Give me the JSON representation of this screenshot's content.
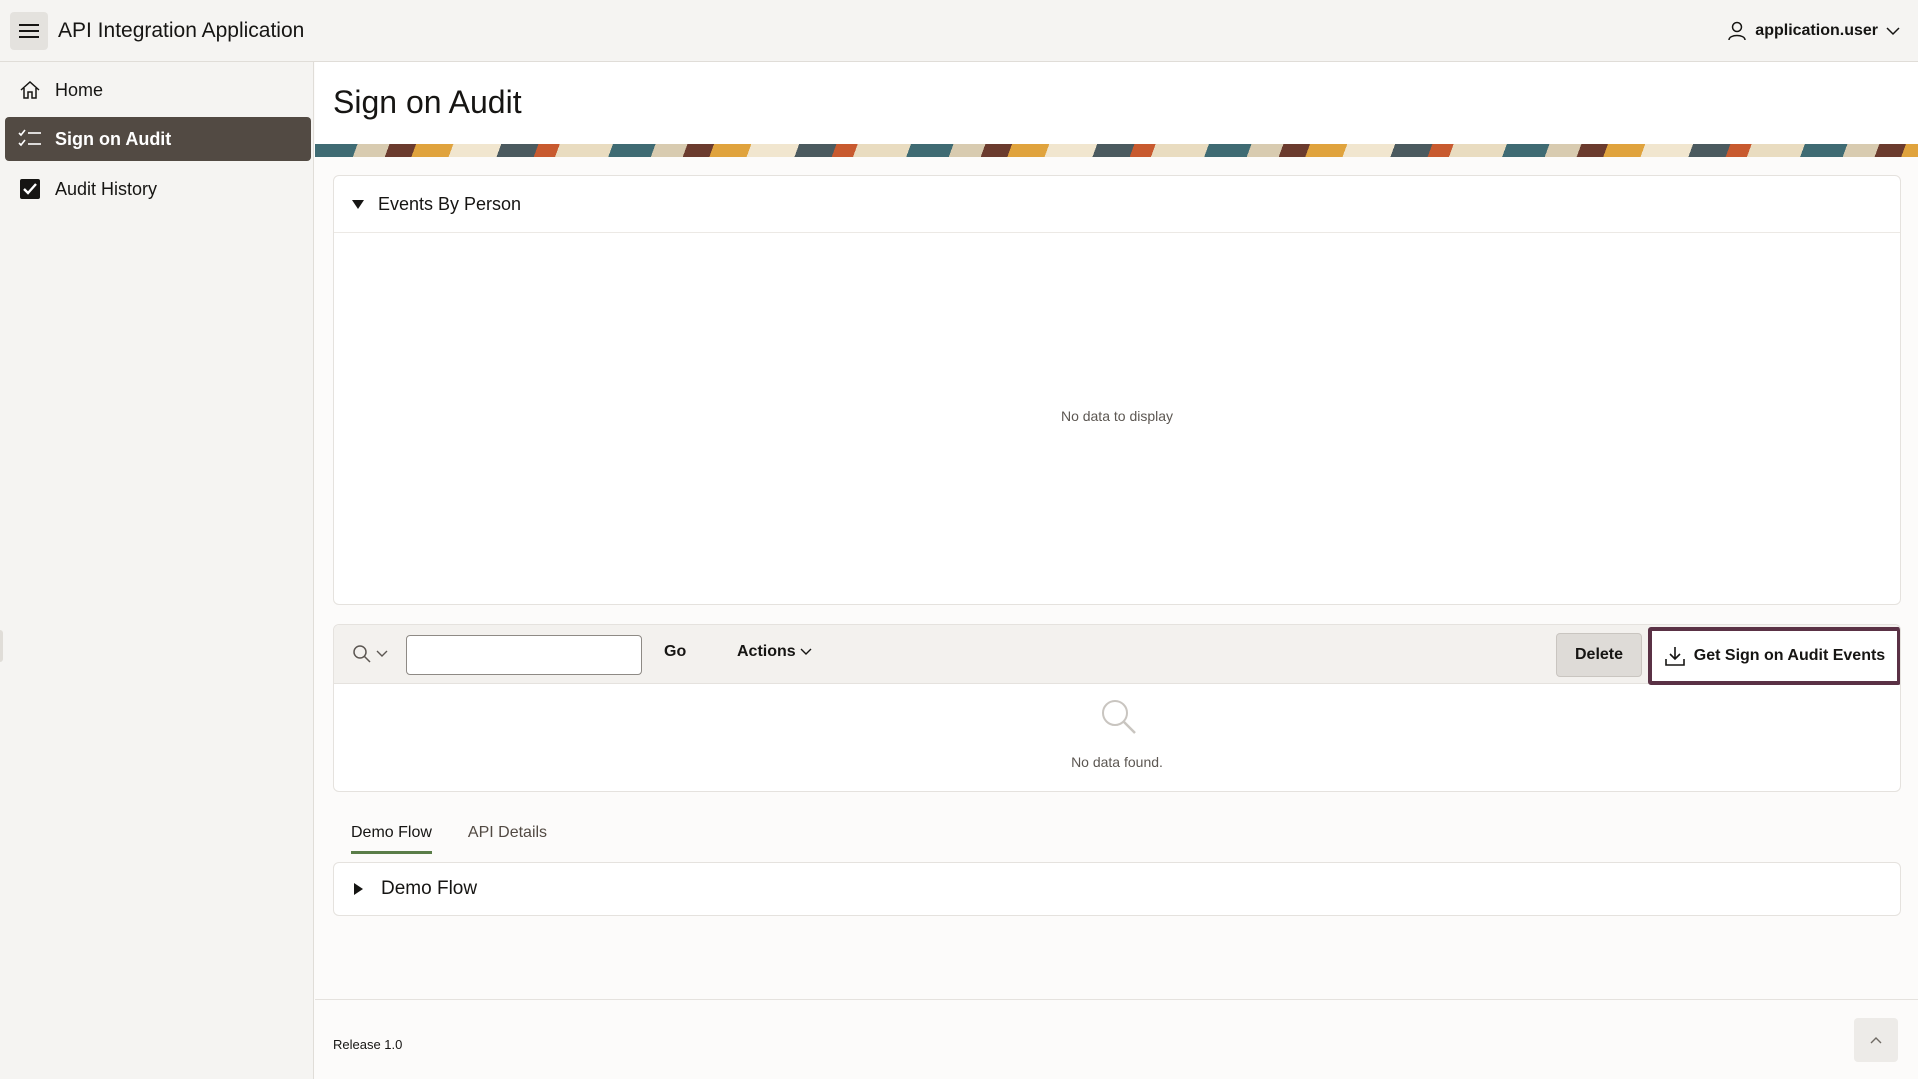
{
  "header": {
    "app_title": "API Integration Application",
    "user": "application.user"
  },
  "sidebar": {
    "items": [
      {
        "label": "Home",
        "icon": "home-icon"
      },
      {
        "label": "Sign on Audit",
        "icon": "checklist-icon",
        "active": true
      },
      {
        "label": "Audit History",
        "icon": "checkbox-icon"
      }
    ]
  },
  "main": {
    "page_title": "Sign on Audit",
    "chart_region": {
      "title": "Events By Person",
      "empty_message": "No data to display"
    },
    "report": {
      "search_placeholder": "",
      "go_label": "Go",
      "actions_label": "Actions",
      "delete_label": "Delete",
      "get_events_label": "Get Sign on Audit Events",
      "empty_message": "No data found."
    },
    "tabs": [
      {
        "label": "Demo Flow",
        "active": true
      },
      {
        "label": "API Details",
        "active": false
      }
    ],
    "flow_region": {
      "title": "Demo Flow"
    }
  },
  "footer": {
    "release": "Release 1.0"
  },
  "colors": {
    "active_nav": "#524a43",
    "highlight_border": "#5a3145",
    "tab_underline": "#5a7d48"
  }
}
